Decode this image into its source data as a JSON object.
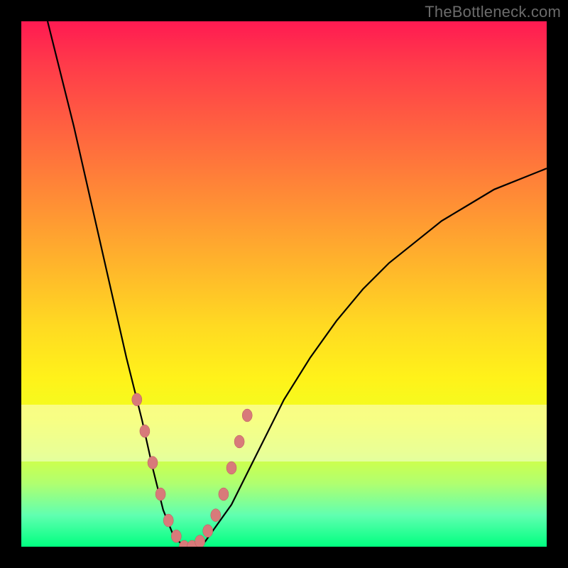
{
  "watermark": "TheBottleneck.com",
  "colors": {
    "frame": "#000000",
    "gradient_top": "#ff1a52",
    "gradient_bottom": "#00ff80",
    "dot_fill": "#d87a7a",
    "curve_stroke": "#000000",
    "pale_band": "rgba(255,255,255,0.45)"
  },
  "chart_data": {
    "type": "line",
    "title": "",
    "xlabel": "",
    "ylabel": "",
    "xlim": [
      0,
      100
    ],
    "ylim": [
      0,
      100
    ],
    "series": [
      {
        "name": "bottleneck-curve",
        "x": [
          5,
          10,
          15,
          20,
          23,
          25,
          27,
          29,
          31,
          33,
          35,
          40,
          45,
          50,
          55,
          60,
          65,
          70,
          75,
          80,
          85,
          90,
          95,
          100
        ],
        "y": [
          100,
          80,
          58,
          36,
          24,
          15,
          7,
          2,
          0,
          0,
          1,
          8,
          18,
          28,
          36,
          43,
          49,
          54,
          58,
          62,
          65,
          68,
          70,
          72
        ]
      }
    ],
    "markers": {
      "name": "highlight-dots",
      "x": [
        22,
        23.5,
        25,
        26.5,
        28,
        29.5,
        31,
        32.5,
        34,
        35.5,
        37,
        38.5,
        40,
        41.5,
        43
      ],
      "y": [
        28,
        22,
        16,
        10,
        5,
        2,
        0,
        0,
        1,
        3,
        6,
        10,
        15,
        20,
        25
      ]
    },
    "pale_band_y": [
      20,
      30
    ]
  }
}
